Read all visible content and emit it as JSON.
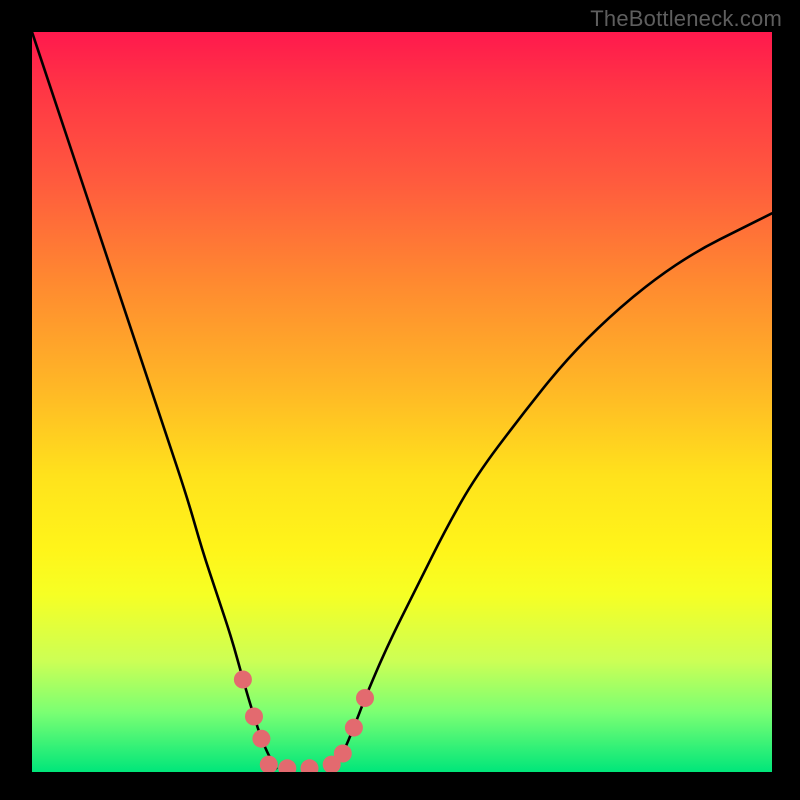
{
  "watermark": {
    "text": "TheBottleneck.com"
  },
  "chart_data": {
    "type": "line",
    "title": "",
    "xlabel": "",
    "ylabel": "",
    "xlim": [
      0,
      1
    ],
    "ylim": [
      0,
      1
    ],
    "legend": null,
    "grid": false,
    "background_gradient": {
      "direction": "vertical",
      "stops": [
        {
          "pos": 0.0,
          "color": "#ff194d"
        },
        {
          "pos": 0.5,
          "color": "#ffcf20"
        },
        {
          "pos": 0.75,
          "color": "#f6ff24"
        },
        {
          "pos": 1.0,
          "color": "#00e67a"
        }
      ]
    },
    "series": [
      {
        "name": "curve-left",
        "stroke": "#000000",
        "x": [
          0.0,
          0.03,
          0.06,
          0.09,
          0.12,
          0.15,
          0.18,
          0.21,
          0.23,
          0.25,
          0.27,
          0.285,
          0.3,
          0.31,
          0.32,
          0.33
        ],
        "y": [
          1.0,
          0.91,
          0.82,
          0.73,
          0.64,
          0.55,
          0.46,
          0.37,
          0.3,
          0.24,
          0.18,
          0.125,
          0.075,
          0.045,
          0.022,
          0.005
        ]
      },
      {
        "name": "curve-right",
        "stroke": "#000000",
        "x": [
          0.41,
          0.42,
          0.435,
          0.45,
          0.48,
          0.52,
          0.56,
          0.6,
          0.66,
          0.72,
          0.78,
          0.84,
          0.9,
          0.96,
          1.0
        ],
        "y": [
          0.005,
          0.025,
          0.06,
          0.1,
          0.17,
          0.25,
          0.33,
          0.4,
          0.48,
          0.555,
          0.615,
          0.665,
          0.705,
          0.735,
          0.755
        ]
      }
    ],
    "markers": [
      {
        "name": "dots-left-branch",
        "color": "#e36a6f",
        "r": 9,
        "x": [
          0.285,
          0.3,
          0.31
        ],
        "y": [
          0.125,
          0.075,
          0.045
        ]
      },
      {
        "name": "dots-bottom",
        "color": "#e36a6f",
        "r": 9,
        "x": [
          0.32,
          0.345,
          0.375,
          0.405
        ],
        "y": [
          0.01,
          0.005,
          0.005,
          0.01
        ]
      },
      {
        "name": "dots-right-branch",
        "color": "#e36a6f",
        "r": 9,
        "x": [
          0.42,
          0.435,
          0.45
        ],
        "y": [
          0.025,
          0.06,
          0.1
        ]
      }
    ]
  }
}
